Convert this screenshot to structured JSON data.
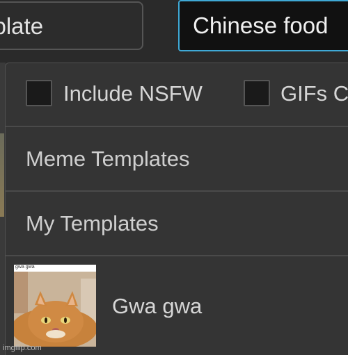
{
  "header": {
    "template_field_text": "mplate",
    "search_value": "Chinese food"
  },
  "dropdown": {
    "filters": {
      "nsfw_label": "Include NSFW",
      "gifs_label": "GIFs C"
    },
    "meme_templates_label": "Meme Templates",
    "my_templates_label": "My Templates",
    "result": {
      "thumb_caption": "gwa gwa",
      "label": "Gwa gwa"
    }
  },
  "watermark": "imgflip.com",
  "colors": {
    "search_border": "#3fa9d6",
    "panel_bg": "#343434",
    "divider": "#4a4a4a"
  }
}
